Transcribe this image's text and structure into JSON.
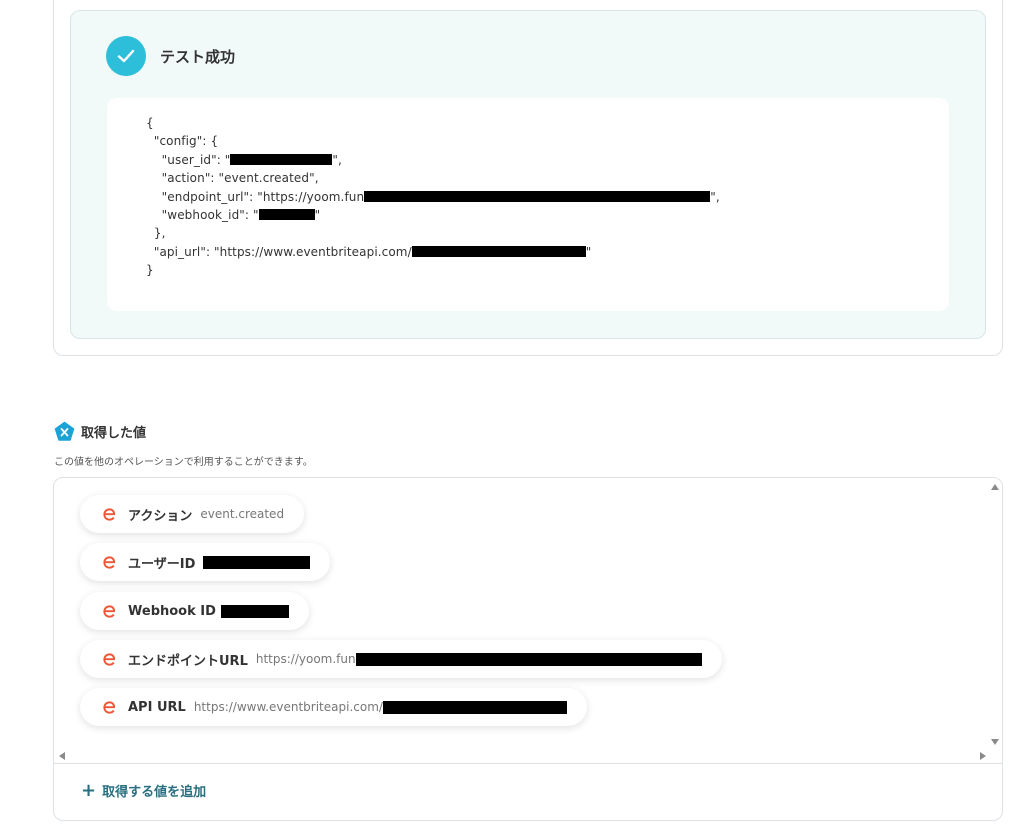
{
  "test_result": {
    "title": "テスト成功",
    "json_lines": [
      "{",
      "  \"config\": {",
      "    \"user_id\": \"",
      "\",",
      "    \"action\": \"event.created\",",
      "    \"endpoint_url\": \"https://yoom.fun",
      "\",",
      "    \"webhook_id\": \"",
      "\"",
      "  },",
      "  \"api_url\": \"https://www.eventbriteapi.com/",
      "\"",
      "}"
    ]
  },
  "acquired": {
    "title": "取得した値",
    "description": "この値を他のオペレーションで利用することができます。",
    "items": [
      {
        "label": "アクション",
        "value": "event.created"
      },
      {
        "label": "ユーザーID",
        "value": ""
      },
      {
        "label": "Webhook ID",
        "value": ""
      },
      {
        "label": "エンドポイントURL",
        "value": "https://yoom.fun"
      },
      {
        "label": "API URL",
        "value": "https://www.eventbriteapi.com/"
      }
    ],
    "add_label": "取得する値を追加"
  },
  "colors": {
    "accent": "#2dbfda",
    "eventbrite": "#f05537",
    "link": "#2a6f80"
  }
}
